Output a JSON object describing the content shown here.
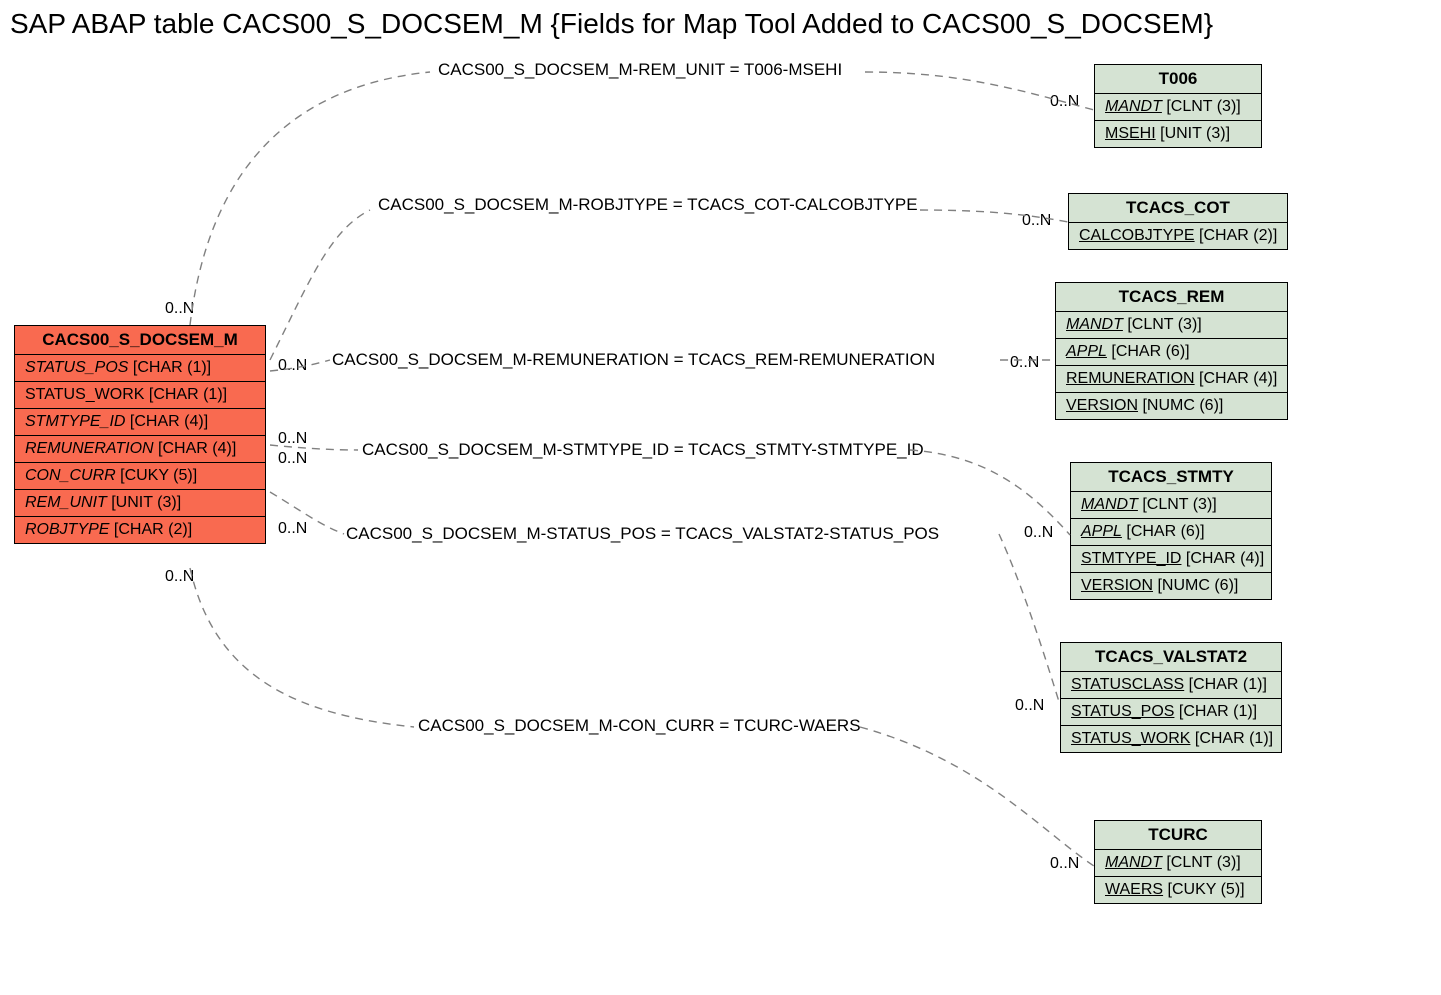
{
  "title": "SAP ABAP table CACS00_S_DOCSEM_M {Fields for Map Tool Added to CACS00_S_DOCSEM}",
  "main_entity": {
    "name": "CACS00_S_DOCSEM_M",
    "fields": [
      {
        "name": "STATUS_POS",
        "type": "[CHAR (1)]",
        "italic": true
      },
      {
        "name": "STATUS_WORK",
        "type": "[CHAR (1)]",
        "italic": false
      },
      {
        "name": "STMTYPE_ID",
        "type": "[CHAR (4)]",
        "italic": true
      },
      {
        "name": "REMUNERATION",
        "type": "[CHAR (4)]",
        "italic": true
      },
      {
        "name": "CON_CURR",
        "type": "[CUKY (5)]",
        "italic": true
      },
      {
        "name": "REM_UNIT",
        "type": "[UNIT (3)]",
        "italic": true
      },
      {
        "name": "ROBJTYPE",
        "type": "[CHAR (2)]",
        "italic": true
      }
    ]
  },
  "entities": [
    {
      "id": "t006",
      "name": "T006",
      "fields": [
        {
          "name": "MANDT",
          "type": "[CLNT (3)]",
          "underline": true,
          "italic": true
        },
        {
          "name": "MSEHI",
          "type": "[UNIT (3)]",
          "underline": true,
          "italic": false
        }
      ]
    },
    {
      "id": "tcacs_cot",
      "name": "TCACS_COT",
      "fields": [
        {
          "name": "CALCOBJTYPE",
          "type": "[CHAR (2)]",
          "underline": true,
          "italic": false
        }
      ]
    },
    {
      "id": "tcacs_rem",
      "name": "TCACS_REM",
      "fields": [
        {
          "name": "MANDT",
          "type": "[CLNT (3)]",
          "underline": true,
          "italic": true
        },
        {
          "name": "APPL",
          "type": "[CHAR (6)]",
          "underline": true,
          "italic": true
        },
        {
          "name": "REMUNERATION",
          "type": "[CHAR (4)]",
          "underline": true,
          "italic": false
        },
        {
          "name": "VERSION",
          "type": "[NUMC (6)]",
          "underline": true,
          "italic": false
        }
      ]
    },
    {
      "id": "tcacs_stmty",
      "name": "TCACS_STMTY",
      "fields": [
        {
          "name": "MANDT",
          "type": "[CLNT (3)]",
          "underline": true,
          "italic": true
        },
        {
          "name": "APPL",
          "type": "[CHAR (6)]",
          "underline": true,
          "italic": true
        },
        {
          "name": "STMTYPE_ID",
          "type": "[CHAR (4)]",
          "underline": true,
          "italic": false
        },
        {
          "name": "VERSION",
          "type": "[NUMC (6)]",
          "underline": true,
          "italic": false
        }
      ]
    },
    {
      "id": "tcacs_valstat2",
      "name": "TCACS_VALSTAT2",
      "fields": [
        {
          "name": "STATUSCLASS",
          "type": "[CHAR (1)]",
          "underline": true,
          "italic": false
        },
        {
          "name": "STATUS_POS",
          "type": "[CHAR (1)]",
          "underline": true,
          "italic": false
        },
        {
          "name": "STATUS_WORK",
          "type": "[CHAR (1)]",
          "underline": true,
          "italic": false
        }
      ]
    },
    {
      "id": "tcurc",
      "name": "TCURC",
      "fields": [
        {
          "name": "MANDT",
          "type": "[CLNT (3)]",
          "underline": true,
          "italic": true
        },
        {
          "name": "WAERS",
          "type": "[CUKY (5)]",
          "underline": true,
          "italic": false
        }
      ]
    }
  ],
  "relationships": [
    {
      "label": "CACS00_S_DOCSEM_M-REM_UNIT = T006-MSEHI"
    },
    {
      "label": "CACS00_S_DOCSEM_M-ROBJTYPE = TCACS_COT-CALCOBJTYPE"
    },
    {
      "label": "CACS00_S_DOCSEM_M-REMUNERATION = TCACS_REM-REMUNERATION"
    },
    {
      "label": "CACS00_S_DOCSEM_M-STMTYPE_ID = TCACS_STMTY-STMTYPE_ID"
    },
    {
      "label": "CACS00_S_DOCSEM_M-STATUS_POS = TCACS_VALSTAT2-STATUS_POS"
    },
    {
      "label": "CACS00_S_DOCSEM_M-CON_CURR = TCURC-WAERS"
    }
  ],
  "cardinalities": {
    "left_top": "0..N",
    "zero_n": "0..N"
  }
}
